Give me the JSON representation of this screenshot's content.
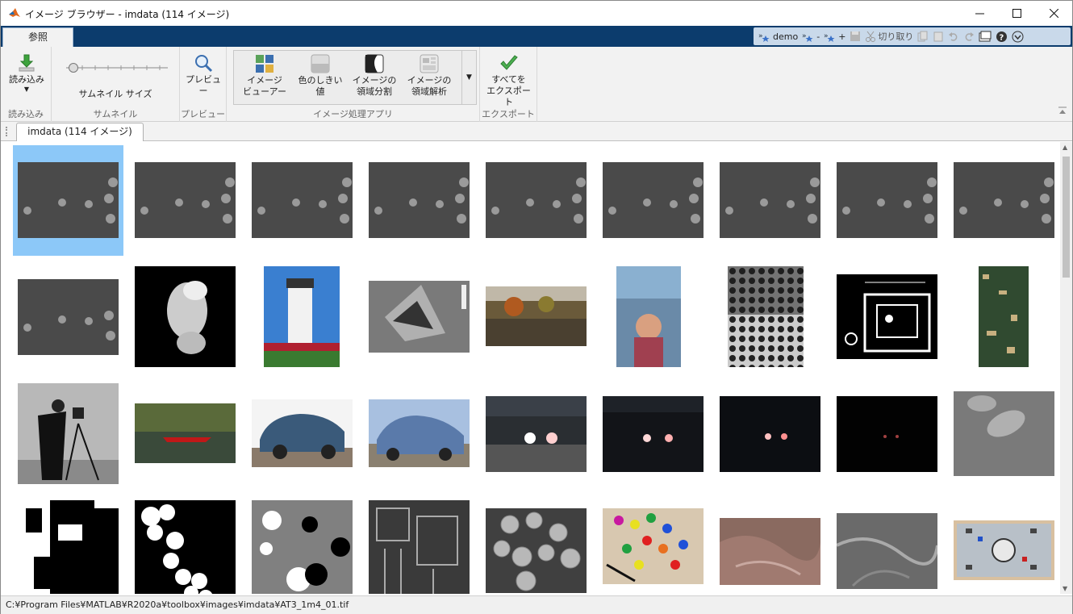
{
  "window": {
    "title": "イメージ ブラウザー - imdata (114 イメージ)",
    "controls": [
      "minimize-icon",
      "maximize-icon",
      "close-icon"
    ]
  },
  "ribbon_tab": {
    "label": "参照"
  },
  "quick_access": {
    "demo_label": "demo",
    "minus": "-",
    "plus": "+",
    "cut_label": "切り取り"
  },
  "ribbon": {
    "load": {
      "label": "読み込み",
      "group": "読み込み"
    },
    "thumbnail": {
      "label": "サムネイル サイズ",
      "group": "サムネイル",
      "slider_value": 0.1
    },
    "preview": {
      "label": "プレビュー",
      "group": "プレビュー"
    },
    "apps": {
      "group": "イメージ処理アプリ",
      "items": [
        {
          "line1": "イメージ",
          "line2": "ビューアー"
        },
        {
          "line1": "色のしきい値",
          "line2": ""
        },
        {
          "line1": "イメージの",
          "line2": "領域分割"
        },
        {
          "line1": "イメージの",
          "line2": "領域解析"
        }
      ]
    },
    "export": {
      "line1": "すべてを",
      "line2": "エクスポート",
      "group": "エクスポート"
    }
  },
  "doc_tab": {
    "label": "imdata (114 イメージ)"
  },
  "status": {
    "path": "C:¥Program Files¥MATLAB¥R2020a¥toolbox¥images¥imdata¥AT3_1m4_01.tif"
  },
  "colors": {
    "title_blue": "#0c3c6d",
    "selection": "#8cc8f8",
    "accent_green": "#3c9a3c"
  }
}
